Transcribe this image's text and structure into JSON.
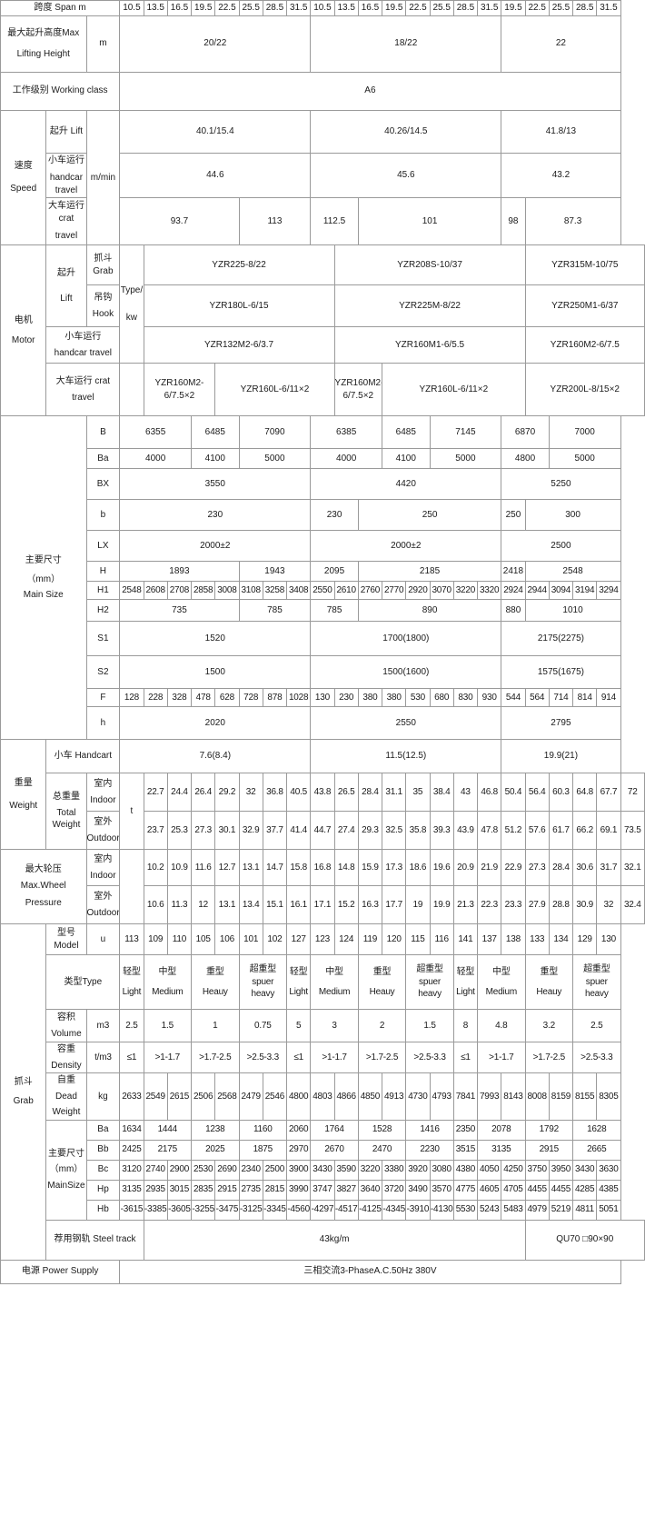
{
  "title": "Grab bucket overhead crane technical specification table",
  "rows": {
    "span": {
      "label": "跨度 Span m",
      "values": [
        "10.5",
        "13.5",
        "16.5",
        "19.5",
        "22.5",
        "25.5",
        "28.5",
        "31.5",
        "10.5",
        "13.5",
        "16.5",
        "19.5",
        "22.5",
        "25.5",
        "28.5",
        "31.5",
        "19.5",
        "22.5",
        "25.5",
        "28.5",
        "31.5"
      ]
    },
    "lift_height": {
      "label_cn": "最大起升高度Max",
      "label_en": "Lifting Height",
      "unit": "m",
      "values": [
        "20/22",
        "18/22",
        "22"
      ]
    },
    "working_class": {
      "label": "工作级别 Working class",
      "value": "A6"
    },
    "speed": {
      "label_cn": "速度",
      "label_en": "Speed",
      "unit": "m/min",
      "lift": {
        "label": "起升 Lift",
        "values": [
          "40.1/15.4",
          "40.26/14.5",
          "41.8/13"
        ]
      },
      "handcar": {
        "label_cn": "小车运行",
        "label_en": "handcar travel",
        "values": [
          "44.6",
          "45.6",
          "43.2"
        ]
      },
      "crab": {
        "label_cn": "大车运行 crat",
        "label_en": "travel",
        "values": [
          "93.7",
          "113",
          "112.5",
          "101",
          "98",
          "87.3"
        ]
      }
    },
    "motor": {
      "label_cn": "电机",
      "label_en": "Motor",
      "unit_top": "Type/",
      "unit_bot": "kw",
      "lift_label_cn": "起升",
      "lift_label_en": "Lift",
      "grab": {
        "label_cn": "抓斗",
        "label_en": "Grab",
        "values": [
          "YZR225-8/22",
          "YZR208S-10/37",
          "YZR315M-10/75"
        ]
      },
      "hook": {
        "label_cn": "吊钩",
        "label_en": "Hook",
        "values": [
          "YZR180L-6/15",
          "YZR225M-8/22",
          "YZR250M1-6/37"
        ]
      },
      "handcar": {
        "label_cn": "小车运行",
        "label_en": "handcar travel",
        "values": [
          "YZR132M2-6/3.7",
          "YZR160M1-6/5.5",
          "YZR160M2-6/7.5"
        ]
      },
      "crab": {
        "label_cn": "大车运行 crat",
        "label_en": "travel",
        "values": [
          "YZR160M2-6/7.5×2",
          "YZR160L-6/11×2",
          "YZR160M2-6/7.5×2",
          "YZR160L-6/11×2",
          "YZR200L-8/15×2"
        ]
      }
    },
    "main_size": {
      "label_cn": "主要尺寸",
      "label_mm": "（mm）",
      "label_en": "Main Size",
      "B": {
        "key": "B",
        "values": [
          "6355",
          "6485",
          "7090",
          "6385",
          "6485",
          "7145",
          "6870",
          "7000"
        ]
      },
      "Ba": {
        "key": "Ba",
        "values": [
          "4000",
          "4100",
          "5000",
          "4000",
          "4100",
          "5000",
          "4800",
          "5000"
        ]
      },
      "BX": {
        "key": "BX",
        "values": [
          "3550",
          "4420",
          "5250"
        ]
      },
      "b": {
        "key": "b",
        "values": [
          "230",
          "230",
          "250",
          "250",
          "300"
        ]
      },
      "LX": {
        "key": "LX",
        "values": [
          "2000±2",
          "2000±2",
          "2500"
        ]
      },
      "H": {
        "key": "H",
        "values": [
          "1893",
          "1943",
          "2095",
          "2185",
          "2418",
          "2548"
        ]
      },
      "H1": {
        "key": "H1",
        "values": [
          "2548",
          "2608",
          "2708",
          "2858",
          "3008",
          "3108",
          "3258",
          "3408",
          "2550",
          "2610",
          "2760",
          "2770",
          "2920",
          "3070",
          "3220",
          "3320",
          "2924",
          "2944",
          "3094",
          "3194",
          "3294"
        ]
      },
      "H2": {
        "key": "H2",
        "values": [
          "735",
          "785",
          "785",
          "890",
          "880",
          "1010"
        ]
      },
      "S1": {
        "key": "S1",
        "values": [
          "1520",
          "1700(1800)",
          "2175(2275)"
        ]
      },
      "S2": {
        "key": "S2",
        "values": [
          "1500",
          "1500(1600)",
          "1575(1675)"
        ]
      },
      "F": {
        "key": "F",
        "values": [
          "128",
          "228",
          "328",
          "478",
          "628",
          "728",
          "878",
          "1028",
          "130",
          "230",
          "380",
          "380",
          "530",
          "680",
          "830",
          "930",
          "544",
          "564",
          "714",
          "814",
          "914"
        ]
      },
      "h": {
        "key": "h",
        "values": [
          "2020",
          "2550",
          "2795"
        ]
      }
    },
    "weight": {
      "label_cn": "重量",
      "label_en": "Weight",
      "total_cn": "总重量",
      "total_en": "Total",
      "total_en2": "Weight",
      "unit": "t",
      "handcart": {
        "label": "小车 Handcart",
        "values": [
          "7.6(8.4)",
          "11.5(12.5)",
          "19.9(21)"
        ]
      },
      "indoor": {
        "label_cn": "室内",
        "label_en": "Indoor",
        "values": [
          "22.7",
          "24.4",
          "26.4",
          "29.2",
          "32",
          "36.8",
          "40.5",
          "43.8",
          "26.5",
          "28.4",
          "31.1",
          "35",
          "38.4",
          "43",
          "46.8",
          "50.4",
          "56.4",
          "60.3",
          "64.8",
          "67.7",
          "72"
        ]
      },
      "outdoor": {
        "label_cn": "室外",
        "label_en": "Outdoor",
        "values": [
          "23.7",
          "25.3",
          "27.3",
          "30.1",
          "32.9",
          "37.7",
          "41.4",
          "44.7",
          "27.4",
          "29.3",
          "32.5",
          "35.8",
          "39.3",
          "43.9",
          "47.8",
          "51.2",
          "57.6",
          "61.7",
          "66.2",
          "69.1",
          "73.5"
        ]
      }
    },
    "wheel_pressure": {
      "label_cn": "最大轮压",
      "label_en1": "Max.Wheel",
      "label_en2": "Pressure",
      "indoor": {
        "label_cn": "室内",
        "label_en": "Indoor",
        "values": [
          "10.2",
          "10.9",
          "11.6",
          "12.7",
          "13.1",
          "14.7",
          "15.8",
          "16.8",
          "14.8",
          "15.9",
          "17.3",
          "18.6",
          "19.6",
          "20.9",
          "21.9",
          "22.9",
          "27.3",
          "28.4",
          "30.6",
          "31.7",
          "32.1"
        ]
      },
      "outdoor": {
        "label_cn": "室外",
        "label_en": "Outdoor",
        "values": [
          "10.6",
          "11.3",
          "12",
          "13.1",
          "13.4",
          "15.1",
          "16.1",
          "17.1",
          "15.2",
          "16.3",
          "17.7",
          "19",
          "19.9",
          "21.3",
          "22.3",
          "23.3",
          "27.9",
          "28.8",
          "30.9",
          "32",
          "32.4"
        ]
      }
    },
    "grab": {
      "label_cn": "抓斗",
      "label_en": "Grab",
      "model": {
        "label_cn": "型号",
        "label_en": "Model",
        "unit": "u",
        "values": [
          "113",
          "109",
          "110",
          "105",
          "106",
          "101",
          "102",
          "127",
          "123",
          "124",
          "119",
          "120",
          "115",
          "116",
          "141",
          "137",
          "138",
          "133",
          "134",
          "129",
          "130"
        ]
      },
      "type": {
        "label": "类型Type",
        "values": [
          {
            "cn": "轻型",
            "en1": "",
            "en2": "Light"
          },
          {
            "cn": "中型",
            "en1": "",
            "en2": "Medium"
          },
          {
            "cn": "重型",
            "en1": "",
            "en2": "Heauy"
          },
          {
            "cn": "超重型",
            "en1": "spuer",
            "en2": "heavy"
          },
          {
            "cn": "轻型",
            "en1": "",
            "en2": "Light"
          },
          {
            "cn": "中型",
            "en1": "",
            "en2": "Medium"
          },
          {
            "cn": "重型",
            "en1": "",
            "en2": "Heauy"
          },
          {
            "cn": "超重型",
            "en1": "spuer",
            "en2": "heavy"
          },
          {
            "cn": "轻型",
            "en1": "",
            "en2": "Light"
          },
          {
            "cn": "中型",
            "en1": "",
            "en2": "Medium"
          },
          {
            "cn": "重型",
            "en1": "",
            "en2": "Heauy"
          },
          {
            "cn": "超重型",
            "en1": "spuer",
            "en2": "heavy"
          }
        ]
      },
      "volume": {
        "label_cn": "容积",
        "label_en": "Volume",
        "unit": "m3",
        "values": [
          "2.5",
          "1.5",
          "1",
          "0.75",
          "5",
          "3",
          "2",
          "1.5",
          "8",
          "4.8",
          "3.2",
          "2.5"
        ]
      },
      "density": {
        "label_cn": "容重",
        "label_en": "Density",
        "unit": "t/m3",
        "values": [
          "≤1",
          ">1-1.7",
          ">1.7-2.5",
          ">2.5-3.3",
          "≤1",
          ">1-1.7",
          ">1.7-2.5",
          ">2.5-3.3",
          "≤1",
          ">1-1.7",
          ">1.7-2.5",
          ">2.5-3.3"
        ]
      },
      "dead_weight": {
        "label_cn": "自重",
        "label_en1": "Dead",
        "label_en2": "Weight",
        "unit": "kg",
        "values": [
          "2633",
          "2549",
          "2615",
          "2506",
          "2568",
          "2479",
          "2546",
          "4800",
          "4803",
          "4866",
          "4850",
          "4913",
          "4730",
          "4793",
          "7841",
          "7993",
          "8143",
          "8008",
          "8159",
          "8155",
          "8305"
        ]
      },
      "main_size": {
        "label_cn": "主要尺寸",
        "label_mm": "（mm）",
        "label_en": "MainSize",
        "Ba": {
          "key": "Ba",
          "values": [
            "1634",
            "1444",
            "1238",
            "1160",
            "2060",
            "1764",
            "1528",
            "1416",
            "2350",
            "2078",
            "1792",
            "1628"
          ]
        },
        "Bb": {
          "key": "Bb",
          "values": [
            "2425",
            "2175",
            "2025",
            "1875",
            "2970",
            "2670",
            "2470",
            "2230",
            "3515",
            "3135",
            "2915",
            "2665"
          ]
        },
        "Bc": {
          "key": "Bc",
          "values": [
            "3120",
            "2740",
            "2900",
            "2530",
            "2690",
            "2340",
            "2500",
            "3900",
            "3430",
            "3590",
            "3220",
            "3380",
            "3920",
            "3080",
            "4380",
            "4050",
            "4250",
            "3750",
            "3950",
            "3430",
            "3630"
          ]
        },
        "Hp": {
          "key": "Hp",
          "values": [
            "3135",
            "2935",
            "3015",
            "2835",
            "2915",
            "2735",
            "2815",
            "3990",
            "3747",
            "3827",
            "3640",
            "3720",
            "3490",
            "3570",
            "4775",
            "4605",
            "4705",
            "4455",
            "4455",
            "4285",
            "4385"
          ]
        },
        "Hb": {
          "key": "Hb",
          "values": [
            "-3615",
            "-3385",
            "-3605",
            "-3255",
            "-3475",
            "-3125",
            "-3345",
            "-4560",
            "-4297",
            "-4517",
            "-4125",
            "-4345",
            "-3910",
            "-4130",
            "5530",
            "5243",
            "5483",
            "4979",
            "5219",
            "4811",
            "5051"
          ]
        }
      }
    },
    "steel_track": {
      "label": "荐用钢轨 Steel track",
      "value_main": "43kg/m",
      "value_right": "QU70 □90×90"
    },
    "power_supply": {
      "label": "电源 Power Supply",
      "value": "三相交流3-PhaseA.C.50Hz 380V"
    }
  }
}
